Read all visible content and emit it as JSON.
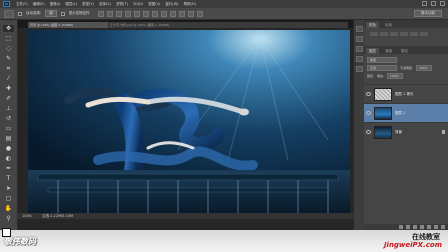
{
  "app": {
    "logo": "Ps"
  },
  "menubar": {
    "items": [
      "文件(F)",
      "编辑(E)",
      "图像(I)",
      "图层(L)",
      "类型(Y)",
      "选择(S)",
      "滤镜(T)",
      "3D(D)",
      "视图(V)",
      "窗口(W)",
      "帮助(H)"
    ]
  },
  "options": {
    "auto_select_label": "自动选择:",
    "auto_select_value": "组",
    "show_transform_label": "显示变换控件",
    "workspace": "基本功能"
  },
  "document": {
    "tab_active": "背景 @ 100% (图层 1, RGB/8)",
    "tab_other": "正十字-方形.psd @ 100% (图层 1, RGB/8)",
    "zoom": "100%",
    "doc_size": "文档:1.22M/5.03M"
  },
  "panels": {
    "top_tabs": [
      "颜色",
      "色板"
    ],
    "layers_tabs": [
      "图层",
      "通道",
      "路径"
    ],
    "blend_mode": "正常",
    "opacity_label": "不透明度:",
    "opacity_value": "100%",
    "lock_label": "锁定:",
    "fill_label": "填充:",
    "fill_value": "100%",
    "kind_select": "类型"
  },
  "layers": [
    {
      "name": "图层 1 拷贝",
      "active": false,
      "thumb": "transparent"
    },
    {
      "name": "图层 1",
      "active": true,
      "thumb": "swimmer"
    },
    {
      "name": "背景",
      "active": false,
      "thumb": "background"
    }
  ],
  "watermark": {
    "left": "敬伟数码",
    "right_top": "在线教室",
    "right_bottom": "JingweiPX.com"
  },
  "colors": {
    "menubar": "#3c3c3c",
    "panel": "#454545",
    "active_layer": "#5b7fa8",
    "url_red": "#c51a1a"
  }
}
